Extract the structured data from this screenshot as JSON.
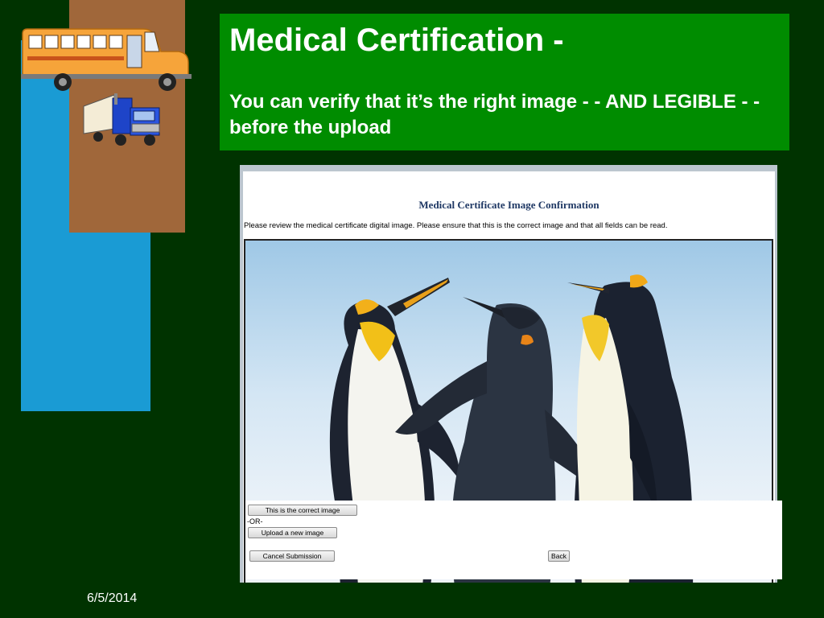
{
  "slide": {
    "title": "Medical Certification -",
    "subtitle": "You  can verify that it’s the right image - - AND LEGIBLE - - before the upload",
    "date": "6/5/2014"
  },
  "screenshot": {
    "heading": "Medical Certificate Image Confirmation",
    "instructions": "Please review the medical certificate digital image. Please ensure that this is the correct image and that all fields can be read.",
    "buttons": {
      "correct_image": "This is the correct image",
      "or_label": "-OR-",
      "upload_new": "Upload a new image",
      "cancel": "Cancel Submission",
      "back": "Back"
    }
  },
  "colors": {
    "background": "#003300",
    "title_box": "#008c00",
    "accent_blue": "#1a9bd4",
    "accent_brown": "#a0673a"
  },
  "icons": [
    "school-bus-icon",
    "semi-truck-icon"
  ]
}
